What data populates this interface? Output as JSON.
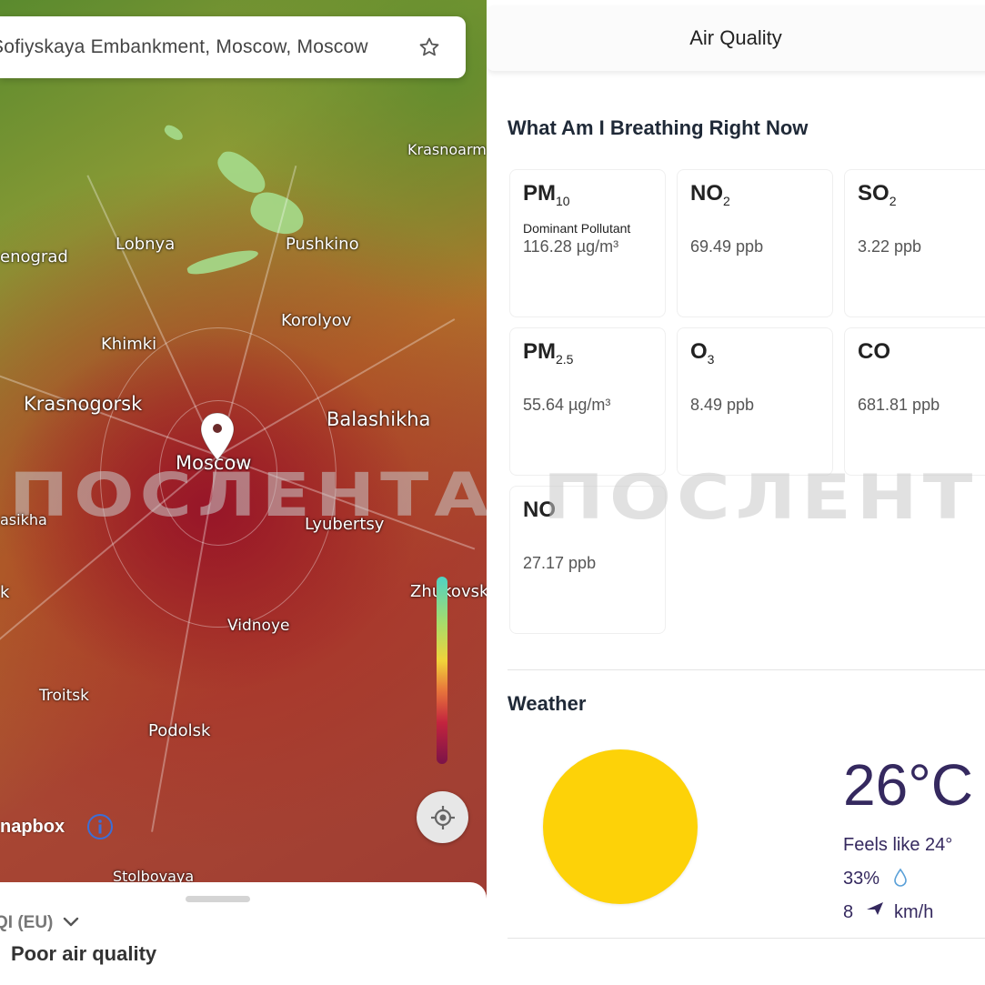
{
  "map": {
    "search_text": "Sofiyskaya Embankment,  Moscow, Moscow",
    "star_icon": "star-outline-icon",
    "cities": {
      "krasnoarmeysk": "Krasnoarm",
      "zelenograd": "enograd",
      "lobnya": "Lobnya",
      "pushkino": "Pushkino",
      "korolyov": "Korolyov",
      "khimki": "Khimki",
      "krasnogorsk": "Krasnogorsk",
      "balashikha": "Balashikha",
      "moscow": "Moscow",
      "vlasikha": "asikha",
      "lyubertsy": "Lyubertsy",
      "k": "k",
      "zhukovsky": "Zhukovsk",
      "vidnoye": "Vidnoye",
      "troitsk": "Troitsk",
      "podolsk": "Podolsk",
      "stolbovaya": "Stolbovaya"
    },
    "attribution": "napbox",
    "watermark": "ПОСЛЕНТА"
  },
  "bottom_sheet": {
    "aqi_label": "QI (EU)",
    "quality_text": "Poor air quality"
  },
  "air_quality": {
    "header": "Air Quality",
    "section_title": "What Am I Breathing Right Now",
    "dominant_label": "Dominant Pollutant",
    "pollutants": [
      {
        "base": "PM",
        "sub": "10",
        "value": "116.28  µg/m³"
      },
      {
        "base": "NO",
        "sub": "2",
        "value": "69.49  ppb"
      },
      {
        "base": "SO",
        "sub": "2",
        "value": "3.22  ppb"
      },
      {
        "base": "PM",
        "sub": "2.5",
        "value": "55.64  µg/m³"
      },
      {
        "base": "O",
        "sub": "3",
        "value": "8.49  ppb"
      },
      {
        "base": "CO",
        "sub": "",
        "value": "681.81  ppb"
      },
      {
        "base": "NO",
        "sub": "",
        "value": "27.17  ppb"
      }
    ],
    "watermark": "ПОСЛЕНТ"
  },
  "weather": {
    "title": "Weather",
    "temperature": "26°C",
    "feels_like": "Feels like 24°",
    "humidity": "33%",
    "wind_speed": "8",
    "wind_unit": "km/h",
    "sun_color": "#fdd208",
    "text_color": "#35295f"
  }
}
